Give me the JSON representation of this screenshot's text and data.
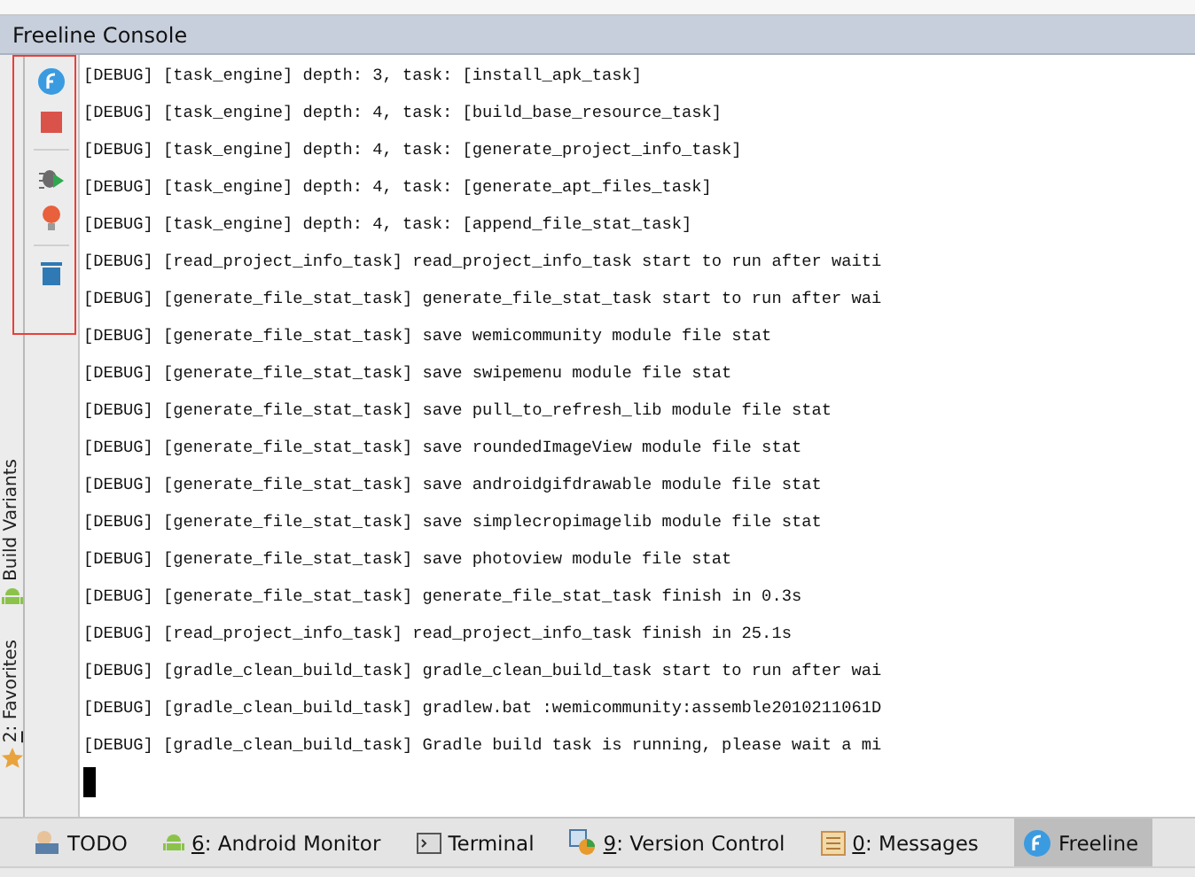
{
  "panel": {
    "title": "Freeline Console"
  },
  "toolbar": [
    {
      "kind": "freeline"
    },
    {
      "kind": "stop"
    },
    {
      "kind": "separator"
    },
    {
      "kind": "debug-run"
    },
    {
      "kind": "bulb"
    },
    {
      "kind": "separator"
    },
    {
      "kind": "trash"
    }
  ],
  "side_tabs": [
    {
      "label": "Build Variants",
      "kind": "android"
    },
    {
      "label": "2: Favorites",
      "kind": "star",
      "mnemonic": true
    }
  ],
  "console_lines": [
    "[DEBUG] [task_engine] depth: 3, task: [install_apk_task]",
    "[DEBUG] [task_engine] depth: 4, task: [build_base_resource_task]",
    "[DEBUG] [task_engine] depth: 4, task: [generate_project_info_task]",
    "[DEBUG] [task_engine] depth: 4, task: [generate_apt_files_task]",
    "[DEBUG] [task_engine] depth: 4, task: [append_file_stat_task]",
    "[DEBUG] [read_project_info_task] read_project_info_task start to run after waiti",
    "[DEBUG] [generate_file_stat_task] generate_file_stat_task start to run after wai",
    "[DEBUG] [generate_file_stat_task] save wemicommunity module file stat",
    "[DEBUG] [generate_file_stat_task] save swipemenu module file stat",
    "[DEBUG] [generate_file_stat_task] save pull_to_refresh_lib module file stat",
    "[DEBUG] [generate_file_stat_task] save roundedImageView module file stat",
    "[DEBUG] [generate_file_stat_task] save androidgifdrawable module file stat",
    "[DEBUG] [generate_file_stat_task] save simplecropimagelib module file stat",
    "[DEBUG] [generate_file_stat_task] save photoview module file stat",
    "[DEBUG] [generate_file_stat_task] generate_file_stat_task finish in 0.3s",
    "[DEBUG] [read_project_info_task] read_project_info_task finish in 25.1s",
    "[DEBUG] [gradle_clean_build_task] gradle_clean_build_task start to run after wai",
    "[DEBUG] [gradle_clean_build_task] gradlew.bat :wemicommunity:assemble2010211061D",
    "[DEBUG] [gradle_clean_build_task] Gradle build task is running, please wait a mi"
  ],
  "bottom_tabs": [
    {
      "label": "TODO",
      "kind": "todo",
      "mnemonic": false,
      "selected": false
    },
    {
      "label": "6: Android Monitor",
      "kind": "android",
      "mnemonic": true,
      "selected": false
    },
    {
      "label": "Terminal",
      "kind": "terminal",
      "mnemonic": false,
      "selected": false
    },
    {
      "label": "9: Version Control",
      "kind": "vcs",
      "mnemonic": true,
      "selected": false
    },
    {
      "label": "0: Messages",
      "kind": "messages",
      "mnemonic": true,
      "selected": false
    },
    {
      "label": "Freeline",
      "kind": "freeline",
      "mnemonic": false,
      "selected": true
    }
  ]
}
